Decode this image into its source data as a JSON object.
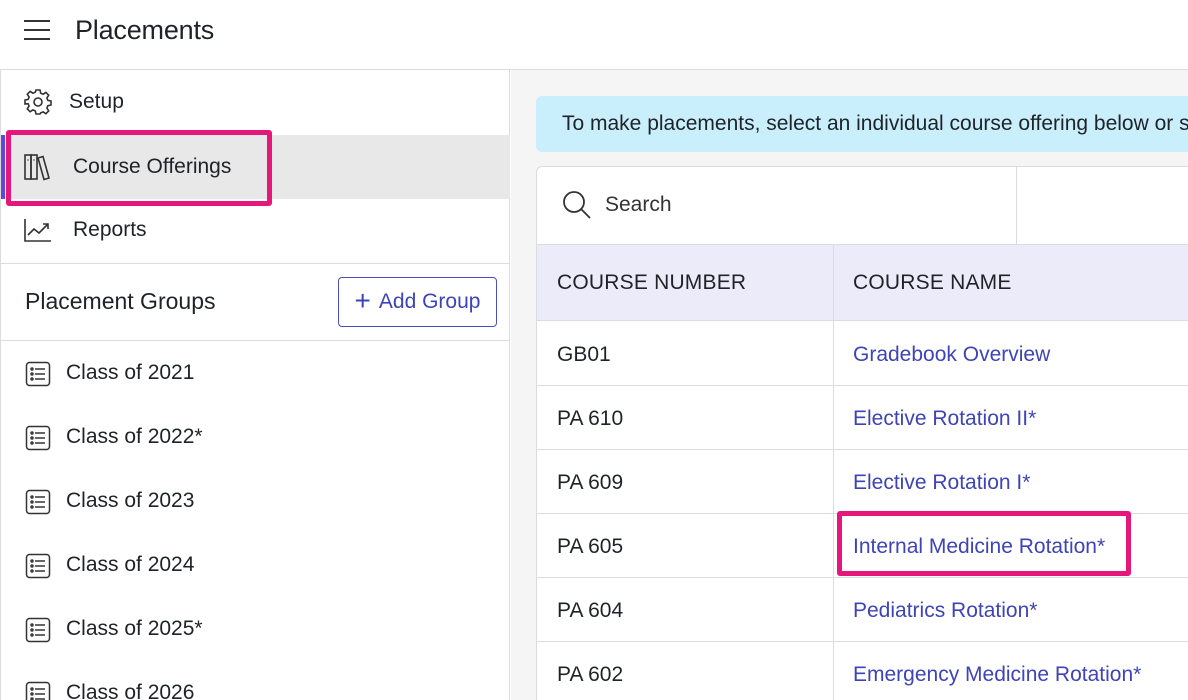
{
  "header": {
    "title": "Placements"
  },
  "sidebar": {
    "nav": [
      {
        "label": "Setup",
        "icon": "gear-icon"
      },
      {
        "label": "Course Offerings",
        "icon": "books-icon",
        "active": true
      },
      {
        "label": "Reports",
        "icon": "chart-icon"
      }
    ],
    "groups_title": "Placement Groups",
    "add_group_label": "Add Group",
    "groups": [
      {
        "label": "Class of 2021"
      },
      {
        "label": "Class of 2022*"
      },
      {
        "label": "Class of 2023"
      },
      {
        "label": "Class of 2024"
      },
      {
        "label": "Class of 2025*"
      },
      {
        "label": "Class of 2026"
      }
    ]
  },
  "main": {
    "banner": "To make placements, select an individual course offering below or se",
    "search": {
      "placeholder": "Search"
    },
    "table": {
      "headers": [
        "COURSE NUMBER",
        "COURSE NAME"
      ],
      "rows": [
        {
          "number": "GB01",
          "name": "Gradebook Overview"
        },
        {
          "number": "PA 610",
          "name": "Elective Rotation II*"
        },
        {
          "number": "PA 609",
          "name": "Elective Rotation I*"
        },
        {
          "number": "PA 605",
          "name": "Internal Medicine Rotation*"
        },
        {
          "number": "PA 604",
          "name": "Pediatrics Rotation*"
        },
        {
          "number": "PA 602",
          "name": "Emergency Medicine Rotation*"
        }
      ]
    }
  },
  "colors": {
    "accent": "#3e44b5",
    "highlight": "#e5177b",
    "banner_bg": "#c9eefc",
    "table_header_bg": "#ebebfa"
  }
}
